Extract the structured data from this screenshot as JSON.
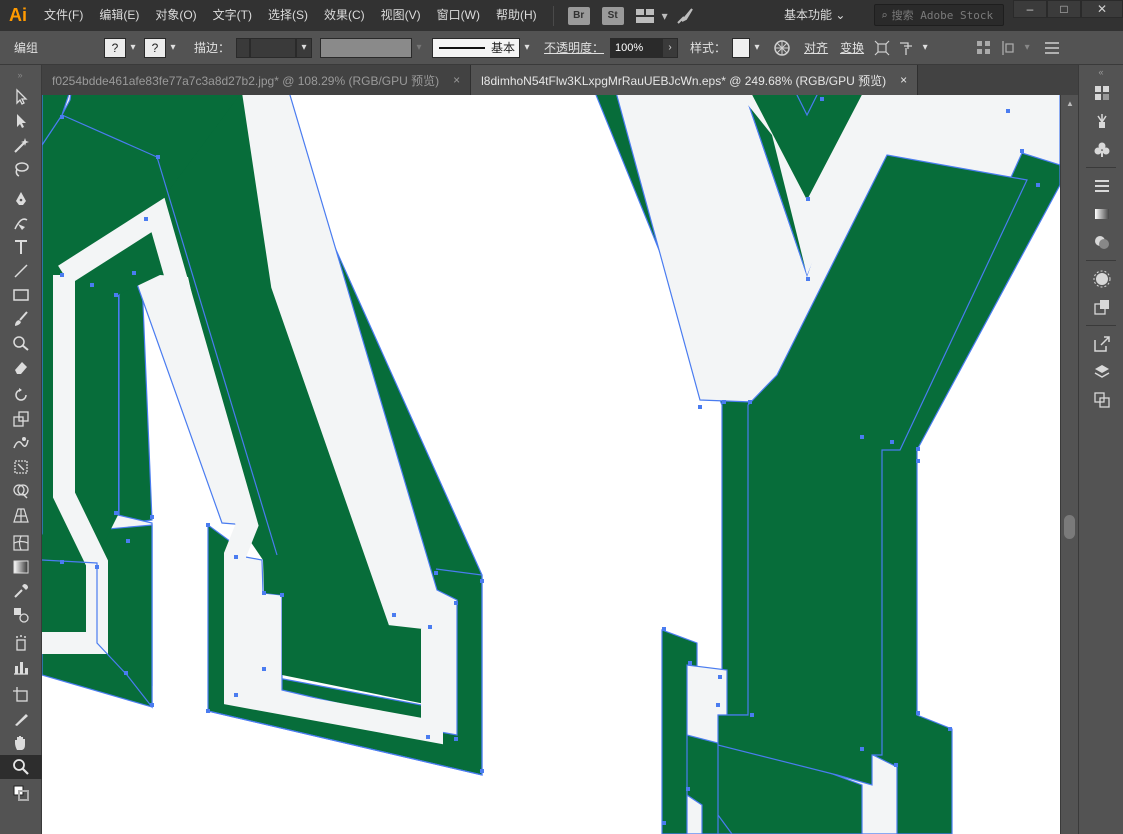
{
  "app": {
    "logo": "Ai"
  },
  "menu": {
    "items": [
      {
        "label": "文件(F)"
      },
      {
        "label": "编辑(E)"
      },
      {
        "label": "对象(O)"
      },
      {
        "label": "文字(T)"
      },
      {
        "label": "选择(S)"
      },
      {
        "label": "效果(C)"
      },
      {
        "label": "视图(V)"
      },
      {
        "label": "窗口(W)"
      },
      {
        "label": "帮助(H)"
      }
    ],
    "bridge_label": "Br",
    "stock_label": "St",
    "workspace": "基本功能",
    "search_placeholder": "搜索 Adobe Stock"
  },
  "control_bar": {
    "selection_label": "编组",
    "fill_value": "?",
    "stroke_value": "?",
    "stroke_label": "描边：",
    "brush_label": "基本",
    "opacity_label": "不透明度：",
    "opacity_value": "100%",
    "style_label": "样式：",
    "align_label": "对齐",
    "transform_label": "变换"
  },
  "tabs": [
    {
      "label": "f0254bdde461afe83fe77a7c3a8d27b2.jpg* @ 108.29% (RGB/GPU 预览)",
      "active": false
    },
    {
      "label": "l8dimhoN54tFlw3KLxpgMrRauUEBJcWn.eps* @ 249.68% (RGB/GPU 预览)",
      "active": true
    }
  ],
  "tab_close_glyph": "×",
  "tools": [
    "selection-tool",
    "direct-selection-tool",
    "magic-wand-tool",
    "lasso-tool",
    "pen-tool",
    "curvature-tool",
    "type-tool",
    "line-segment-tool",
    "rectangle-tool",
    "paintbrush-tool",
    "shaper-tool",
    "eraser-tool",
    "rotate-tool",
    "scale-tool",
    "warp-tool",
    "free-transform-tool",
    "shape-builder-tool",
    "perspective-grid-tool",
    "mesh-tool",
    "gradient-tool",
    "eyedropper-tool",
    "blend-tool",
    "symbol-sprayer-tool",
    "column-graph-tool",
    "artboard-tool",
    "slice-tool",
    "hand-tool",
    "zoom-tool"
  ],
  "colors": {
    "artwork_green": "#076d3a",
    "artwork_white": "#f3f5f6",
    "path_blue": "#4a7cf0",
    "canvas": "#ffffff",
    "ui_dark": "#323232",
    "ui_mid": "#535353"
  }
}
